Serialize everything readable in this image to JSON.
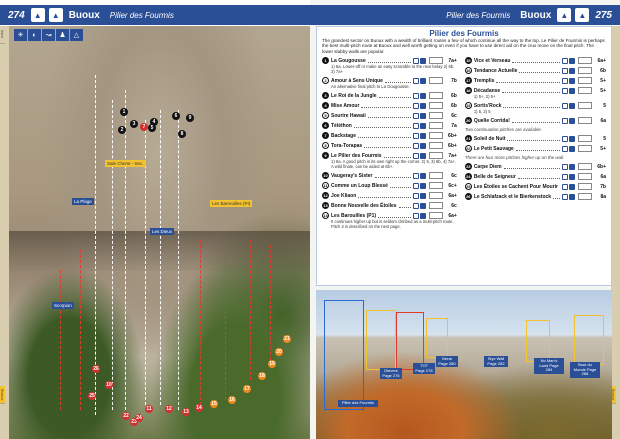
{
  "left_page": {
    "page_number": "274",
    "header_title": "Buoux",
    "header_subtitle": "Pilier des Fourmis",
    "icons": [
      "sun-icon",
      "shade-icon",
      "walk-icon",
      "family-icon",
      "climber-icon"
    ],
    "tabs": [
      "Intro",
      "",
      "",
      "",
      "",
      "",
      "",
      "",
      "",
      "",
      "",
      "",
      "",
      "",
      "",
      "",
      "",
      "",
      "",
      "",
      "Buoux"
    ],
    "photo_labels": [
      {
        "text": "La Plage"
      },
      {
        "text": "Les Dieux"
      },
      {
        "text": "Les Barreuilles (PI)"
      },
      {
        "text": "Sale Chene - Sec."
      },
      {
        "text": "Scorpion"
      }
    ],
    "pins": [
      "1",
      "2",
      "3",
      "4",
      "5",
      "6",
      "7",
      "8",
      "9",
      "10",
      "11",
      "12",
      "13",
      "14",
      "15",
      "16",
      "17",
      "18",
      "19",
      "20",
      "21",
      "22",
      "23",
      "24",
      "25",
      "26"
    ]
  },
  "right_page": {
    "page_number": "275",
    "header_title": "Buoux",
    "header_subtitle": "Pilier des Fourmis",
    "section_title": "Pilier des Fourmis",
    "intro": "The grandest sector on Buoux with a wealth of brilliant routes a few of which continue all the way to the top. Le Pilier de Fourmis is perhaps the best multi-pitch route at Buoux and well worth getting on even if you have to use direct aid on the crux move on the final pitch. The lower slabby walls are popular.",
    "routes_left": [
      {
        "num": "1",
        "name": "La Gougousse",
        "grade": "7a+",
        "desc": "1) 6a. Lower-off or make an easy scramble to the next belay 2) 6b, 3) 7a+"
      },
      {
        "num": "2",
        "name": "Amour à Sens Unique",
        "grade": "7b",
        "desc": "An alternative final pitch to La Gougousse."
      },
      {
        "num": "3",
        "name": "Le Roi de la Jungle",
        "grade": "6b",
        "desc": ""
      },
      {
        "num": "4",
        "name": "Mise Amour",
        "grade": "6b",
        "desc": ""
      },
      {
        "num": "5",
        "name": "Sourire Hawaii",
        "grade": "6c",
        "desc": ""
      },
      {
        "num": "6",
        "name": "Téléthon",
        "grade": "7a",
        "desc": ""
      },
      {
        "num": "7",
        "name": "Backstage",
        "grade": "6b+",
        "desc": ""
      },
      {
        "num": "8",
        "name": "Tora-Torapas",
        "grade": "6b+",
        "desc": ""
      },
      {
        "num": "9",
        "name": "Le Pilier des Fourmis",
        "grade": "7a+",
        "desc": "1) 6a. A good pitch in its own right up the corner. 2) 5, 3) 6b, 4) 7a+. A wild finale, can be aided at 6b+."
      },
      {
        "num": "10",
        "name": "Vaugeray's Sister",
        "grade": "6c",
        "desc": ""
      },
      {
        "num": "11",
        "name": "Comme un Loup Blessé",
        "grade": "6c+",
        "desc": ""
      },
      {
        "num": "12",
        "name": "Joe Kliaon",
        "grade": "6a+",
        "desc": ""
      },
      {
        "num": "13",
        "name": "Bonne Nouvelle des Étoiles",
        "grade": "6c",
        "desc": ""
      },
      {
        "num": "14",
        "name": "Les Barouilles (P1)",
        "grade": "6a+",
        "desc": "It continues higher up but is seldom climbed as a multi-pitch route. Pitch 2 is described on the next page."
      }
    ],
    "routes_right": [
      {
        "num": "15",
        "name": "Vice et Verseau",
        "grade": "6a+",
        "desc": ""
      },
      {
        "num": "16",
        "name": "Tendance Actuelle",
        "grade": "6b",
        "desc": ""
      },
      {
        "num": "17",
        "name": "Tremplis",
        "grade": "5+",
        "desc": ""
      },
      {
        "num": "18",
        "name": "Décadanse",
        "grade": "5+",
        "desc": "1) 5+, 2) 5+"
      },
      {
        "num": "19",
        "name": "Sortis'Rock",
        "grade": "5",
        "desc": "1) 5, 2) 5"
      },
      {
        "num": "20",
        "name": "Quelle Corrida!",
        "grade": "6a",
        "desc": ""
      },
      {
        "num": "21",
        "name": "Soleil de Nuit",
        "grade": "5",
        "desc": ""
      },
      {
        "num": "22",
        "name": "Le Petit Sauvage",
        "grade": "5+",
        "desc": ""
      },
      {
        "num": "23",
        "name": "Carpe Diem",
        "grade": "6b+",
        "desc": ""
      },
      {
        "num": "24",
        "name": "Belle de Seigneur",
        "grade": "6a",
        "desc": ""
      },
      {
        "num": "25",
        "name": "Les Étoiles se Cachent Pour Mourir",
        "grade": "7b",
        "desc": ""
      },
      {
        "num": "26",
        "name": "Le Schlafzack et le Bierkenstock",
        "grade": "8a",
        "desc": ""
      }
    ],
    "notes": [
      "Two continuation pitches are available.",
      "There are four more pitches higher up on the wall."
    ],
    "photo_labels": [
      {
        "text": "Pilier des Fourmis"
      },
      {
        "text": "Dievers Page 276"
      },
      {
        "text": "TCF Page 278"
      },
      {
        "text": "Bérat Page 280"
      },
      {
        "text": "Styx Wall Page 282"
      },
      {
        "text": "No Man's Land Page 284"
      },
      {
        "text": "Bout du Monde Page 286"
      }
    ],
    "tabs": [
      "",
      "",
      "",
      "",
      "",
      "",
      "",
      "",
      "",
      "",
      "",
      "",
      "",
      "",
      "",
      "",
      "",
      "",
      "",
      "",
      "Buoux"
    ]
  },
  "colors": {
    "brand_blue": "#2b4f96",
    "tab_bg": "#d9cdb0",
    "tab_active": "#f2c230",
    "topo_red": "#e23b2e"
  }
}
